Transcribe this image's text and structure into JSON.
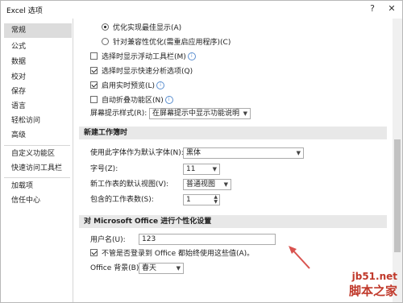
{
  "window": {
    "title": "Excel 选项",
    "help": "?",
    "close": "✕"
  },
  "sidebar": {
    "items": [
      {
        "label": "常规"
      },
      {
        "label": "公式"
      },
      {
        "label": "数据"
      },
      {
        "label": "校对"
      },
      {
        "label": "保存"
      },
      {
        "label": "语言"
      },
      {
        "label": "轻松访问"
      },
      {
        "label": "高级"
      },
      {
        "label": "自定义功能区"
      },
      {
        "label": "快速访问工具栏"
      },
      {
        "label": "加载项"
      },
      {
        "label": "信任中心"
      }
    ]
  },
  "ui_options": {
    "radio1": "优化实现最佳显示(A)",
    "radio2": "针对兼容性优化(需重启应用程序)(C)",
    "cb1": "选择时显示浮动工具栏(M)",
    "cb2": "选择时显示快速分析选项(Q)",
    "cb3": "启用实时预览(L)",
    "cb4": "自动折叠功能区(N)",
    "tooltip_label": "屏幕提示样式(R):",
    "tooltip_value": "在屏幕提示中显示功能说明"
  },
  "new_workbook": {
    "header": "新建工作簿时",
    "font_label": "使用此字体作为默认字体(N):",
    "font_value": "黑体",
    "size_label": "字号(Z):",
    "size_value": "11",
    "view_label": "新工作表的默认视图(V):",
    "view_value": "普通视图",
    "sheets_label": "包含的工作表数(S):",
    "sheets_value": "1"
  },
  "personalize": {
    "header": "对 Microsoft Office 进行个性化设置",
    "username_label": "用户名(U):",
    "username_value": "123",
    "always_use": "不管是否登录到 Office 都始终使用这些值(A)。",
    "background_label": "Office 背景(B):",
    "background_value": "春天"
  },
  "watermark": {
    "line1": "jb51.net",
    "line2": "脚本之家"
  }
}
